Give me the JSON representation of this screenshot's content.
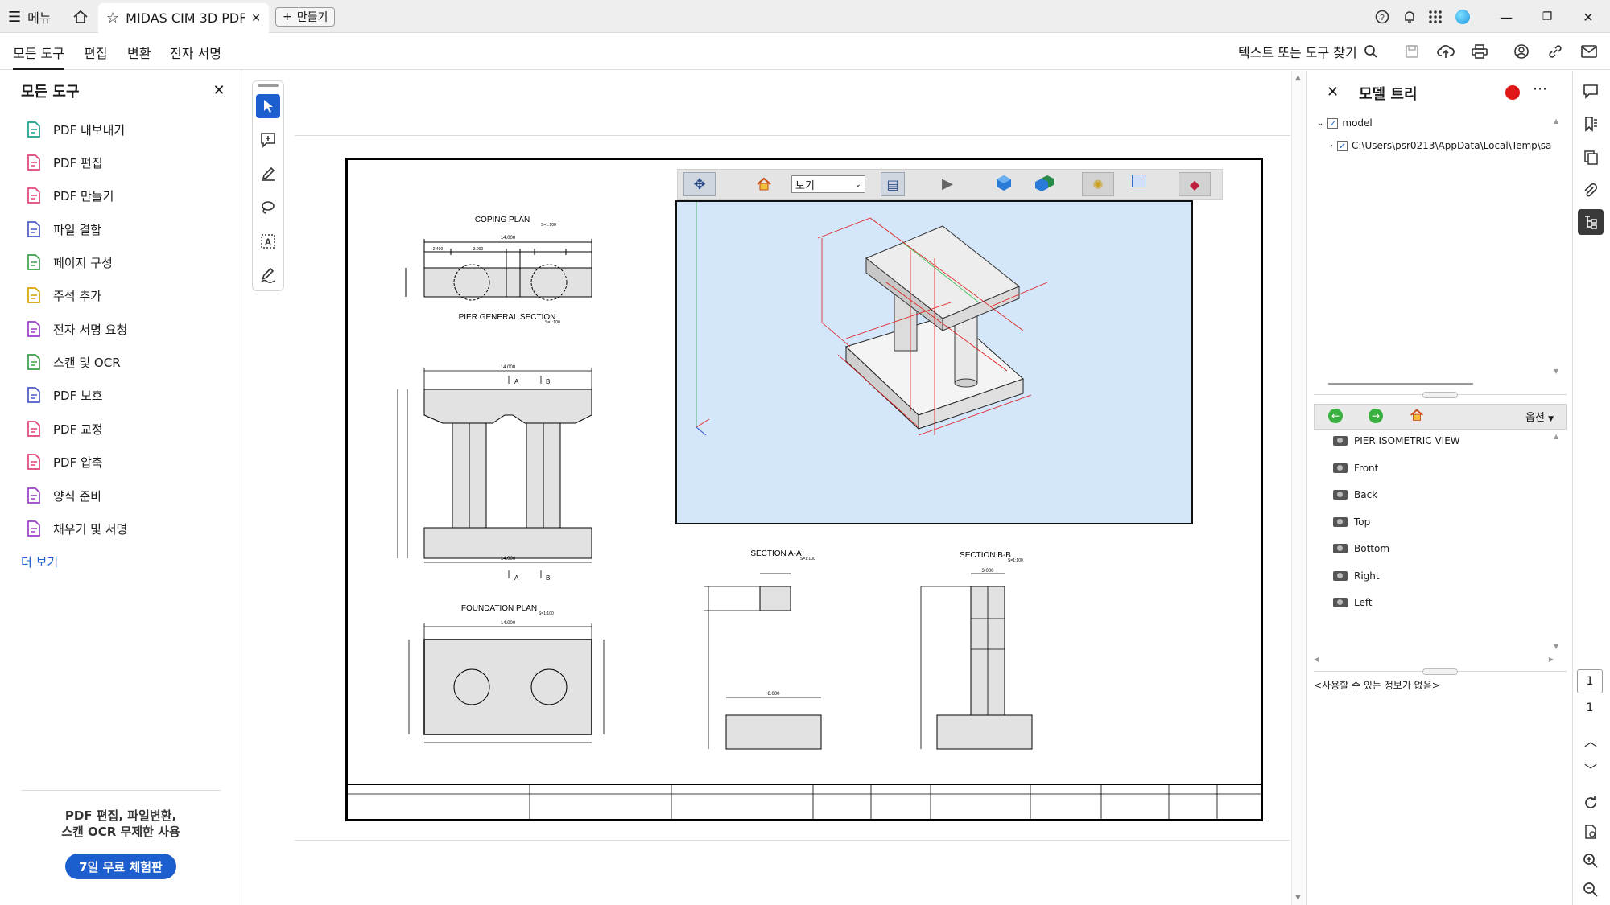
{
  "titlebar": {
    "menu_label": "메뉴",
    "tab_title": "MIDAS CIM 3D PDF ...",
    "new_tab_label": "만들기"
  },
  "menubar": {
    "items": [
      "모든 도구",
      "편집",
      "변환",
      "전자 서명"
    ],
    "find_tools": "텍스트 또는 도구 찾기"
  },
  "left_panel": {
    "title": "모든 도구",
    "tools": [
      {
        "label": "PDF 내보내기",
        "icon": "export-pdf-icon",
        "color": "#1aa08a"
      },
      {
        "label": "PDF 편집",
        "icon": "edit-pdf-icon",
        "color": "#e0437a"
      },
      {
        "label": "PDF 만들기",
        "icon": "create-pdf-icon",
        "color": "#e0437a"
      },
      {
        "label": "파일 결합",
        "icon": "combine-files-icon",
        "color": "#4a5ac8"
      },
      {
        "label": "페이지 구성",
        "icon": "organize-pages-icon",
        "color": "#3aa04a"
      },
      {
        "label": "주석 추가",
        "icon": "comment-icon",
        "color": "#d6a400"
      },
      {
        "label": "전자 서명 요청",
        "icon": "request-esign-icon",
        "color": "#9a3ec8"
      },
      {
        "label": "스캔 및 OCR",
        "icon": "scan-ocr-icon",
        "color": "#3aa04a"
      },
      {
        "label": "PDF 보호",
        "icon": "protect-pdf-icon",
        "color": "#4a5ac8"
      },
      {
        "label": "PDF 교정",
        "icon": "redact-pdf-icon",
        "color": "#e0437a"
      },
      {
        "label": "PDF 압축",
        "icon": "compress-pdf-icon",
        "color": "#e0437a"
      },
      {
        "label": "양식 준비",
        "icon": "prepare-form-icon",
        "color": "#9a3ec8"
      },
      {
        "label": "채우기 및 서명",
        "icon": "fill-sign-icon",
        "color": "#9a3ec8"
      }
    ],
    "more_label": "더 보기",
    "promo_line1": "PDF 편집, 파일변환,",
    "promo_line2": "스캔 OCR 무제한 사용",
    "trial_button": "7일 무료 체험판"
  },
  "drawing": {
    "coping_title": "COPING PLAN",
    "pier_title": "PIER GENERAL SECTION",
    "foundation_title": "FOUNDATION PLAN",
    "section_a_title": "SECTION A-A",
    "section_b_title": "SECTION B-B",
    "scale": "S=1:100",
    "dim_14000": "14.000",
    "dim_3000": "3.000",
    "dim_2400": "2.400",
    "dim_8000": "8.000",
    "marker_a": "A",
    "marker_b": "B"
  },
  "viewer": {
    "view_select": "보기"
  },
  "model_tree": {
    "title": "모델 트리",
    "root": "model",
    "child": "C:\\Users\\psr0213\\AppData\\Local\\Temp\\sa",
    "options_label": "옵션",
    "views": [
      "PIER ISOMETRIC VIEW",
      "Front",
      "Back",
      "Top",
      "Bottom",
      "Right",
      "Left"
    ],
    "no_info": "<사용할 수 있는 정보가 없음>"
  },
  "page_nav": {
    "current": "1",
    "total": "1"
  },
  "colors": {
    "accent": "#1d5ecf",
    "viewer_bg": "#d3e6fa",
    "model_red": "#e01818"
  }
}
